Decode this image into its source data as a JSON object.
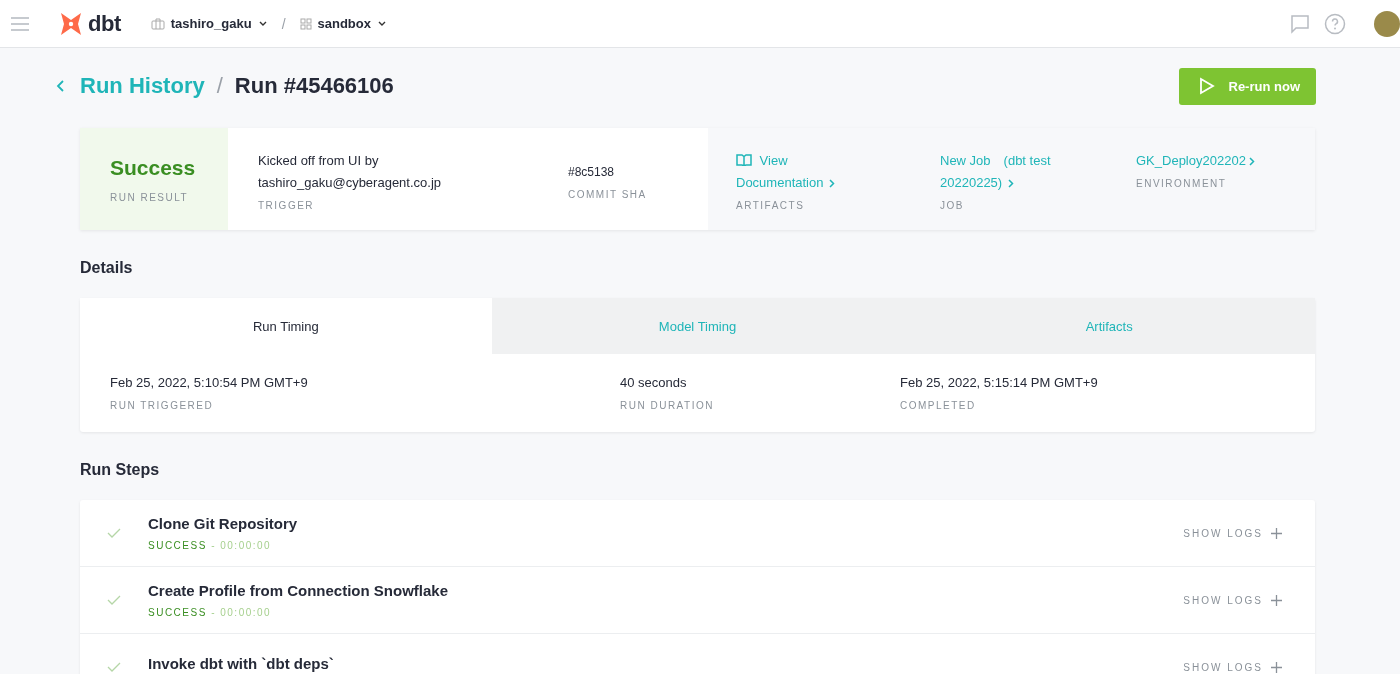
{
  "header": {
    "logo_text": "dbt",
    "account": "tashiro_gaku",
    "project": "sandbox",
    "separator": "/"
  },
  "breadcrumb": {
    "parent": "Run History",
    "separator": "/",
    "current": "Run #45466106"
  },
  "rerun_button": {
    "label": "Re-run now"
  },
  "summary": {
    "result": {
      "value": "Success",
      "label": "RUN RESULT"
    },
    "trigger": {
      "value": "Kicked off from UI by tashiro_gaku@cyberagent.co.jp",
      "label": "TRIGGER"
    },
    "commit": {
      "value": "#8c5138",
      "label": "COMMIT SHA"
    },
    "artifacts": {
      "value": "View Documentation",
      "label": "ARTIFACTS"
    },
    "job": {
      "value": "New Job　(dbt test 20220225)",
      "label": "JOB"
    },
    "environment": {
      "value": "GK_Deploy202202",
      "label": "ENVIRONMENT"
    }
  },
  "details": {
    "title": "Details",
    "tabs": [
      {
        "label": "Run Timing",
        "selected": true
      },
      {
        "label": "Model Timing",
        "selected": false
      },
      {
        "label": "Artifacts",
        "selected": false
      }
    ],
    "timing": [
      {
        "value": "Feb 25, 2022, 5:10:54 PM GMT+9",
        "label": "RUN TRIGGERED"
      },
      {
        "value": "40 seconds",
        "label": "RUN DURATION"
      },
      {
        "value": "Feb 25, 2022, 5:15:14 PM GMT+9",
        "label": "COMPLETED"
      }
    ]
  },
  "run_steps": {
    "title": "Run Steps",
    "steps": [
      {
        "name": "Clone Git Repository",
        "status": "SUCCESS",
        "duration": "- 00:00:00",
        "action_label": "SHOW LOGS"
      },
      {
        "name": "Create Profile from Connection Snowflake",
        "status": "SUCCESS",
        "duration": "- 00:00:00",
        "action_label": "SHOW LOGS"
      },
      {
        "name": "Invoke dbt with `dbt deps`",
        "action_label": "SHOW LOGS"
      }
    ]
  }
}
